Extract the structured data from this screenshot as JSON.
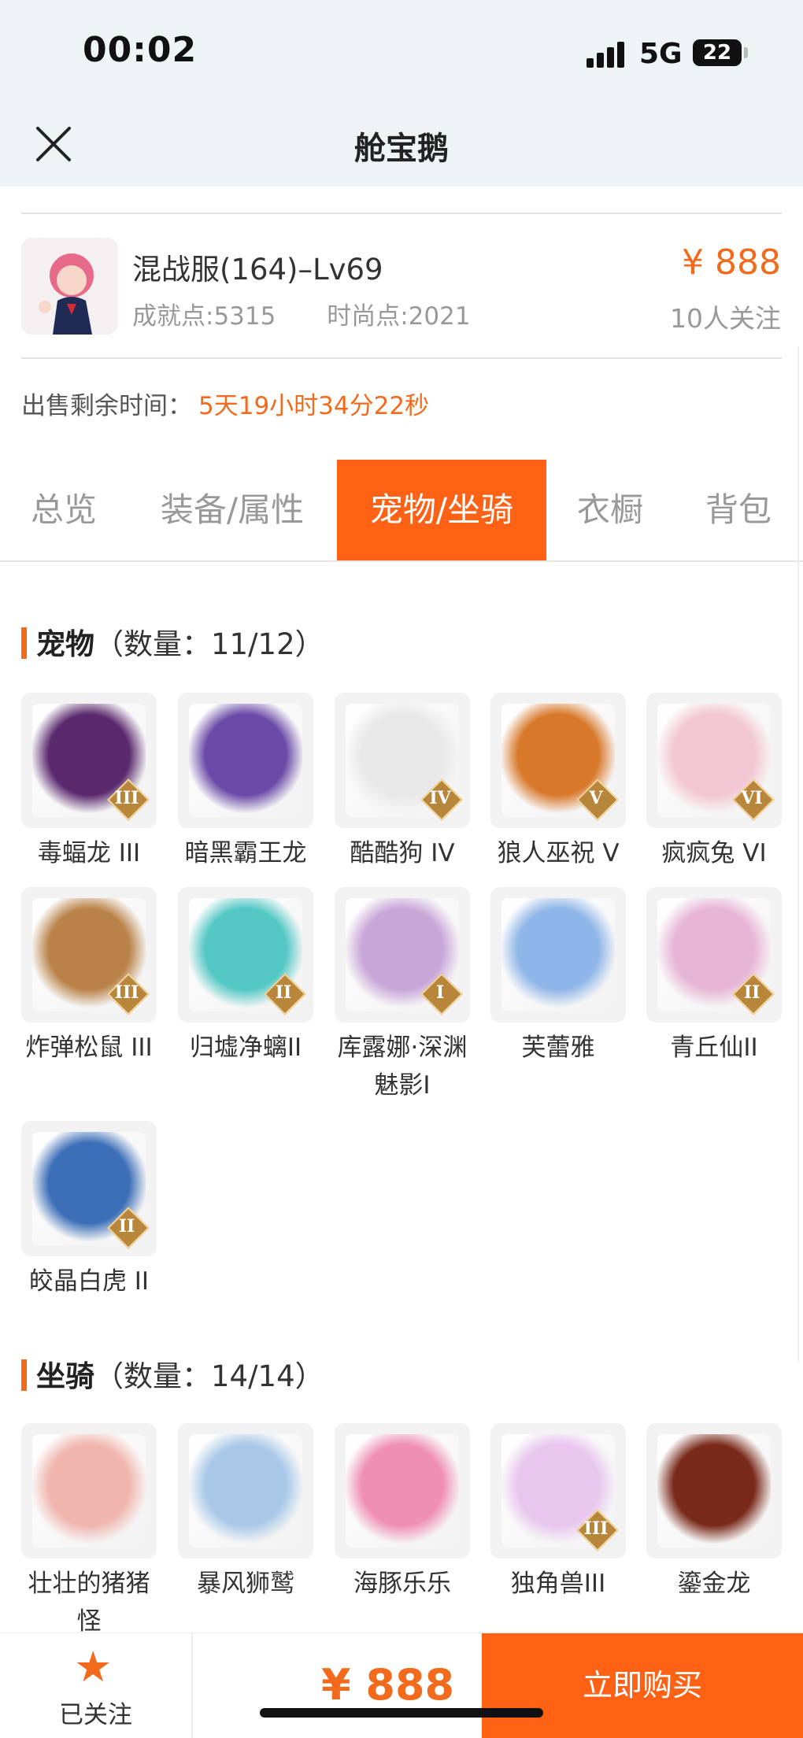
{
  "status": {
    "time": "00:02",
    "network": "5G",
    "battery": "22"
  },
  "nav": {
    "title": "舱宝鹅"
  },
  "character": {
    "name": "混战服(164)–Lv69",
    "achievement": "成就点:5315",
    "fashion": "时尚点:2021",
    "price": "¥ 888",
    "followers": "10人关注"
  },
  "sale": {
    "label": "出售剩余时间：",
    "remaining": "5天19小时34分22秒"
  },
  "tabs": [
    "总览",
    "装备/属性",
    "宠物/坐骑",
    "衣橱",
    "背包"
  ],
  "active_tab": 2,
  "pets": {
    "title": "宠物",
    "count": "（数量：11/12）",
    "items": [
      {
        "name": "毒蝠龙 III",
        "rank": "III",
        "color": "#5b2a6e"
      },
      {
        "name": "暗黑霸王龙",
        "rank": "",
        "color": "#6b4aa8"
      },
      {
        "name": "酷酷狗 IV",
        "rank": "IV",
        "color": "#e8e8e8"
      },
      {
        "name": "狼人巫祝 V",
        "rank": "V",
        "color": "#d8782a"
      },
      {
        "name": "疯疯兔 VI",
        "rank": "VI",
        "color": "#f2c6d2"
      },
      {
        "name": "炸弹松鼠 III",
        "rank": "III",
        "color": "#b98248"
      },
      {
        "name": "归墟净螭II",
        "rank": "II",
        "color": "#52c7c4"
      },
      {
        "name": "库露娜·深渊魅影I",
        "rank": "I",
        "color": "#c9a6d8"
      },
      {
        "name": "芙蕾雅",
        "rank": "",
        "color": "#8fb6e8"
      },
      {
        "name": "青丘仙II",
        "rank": "II",
        "color": "#e7b6d6"
      },
      {
        "name": "皎晶白虎 II",
        "rank": "II",
        "color": "#3d6fb8"
      }
    ]
  },
  "mounts": {
    "title": "坐骑",
    "count": "（数量：14/14）",
    "items": [
      {
        "name": "壮壮的猪猪怪",
        "rank": "",
        "color": "#f0b6ae"
      },
      {
        "name": "暴风狮鹫",
        "rank": "",
        "color": "#a9c8e8"
      },
      {
        "name": "海豚乐乐",
        "rank": "",
        "color": "#ef8fb2"
      },
      {
        "name": "独角兽III",
        "rank": "III",
        "color": "#e8c6ee"
      },
      {
        "name": "鎏金龙",
        "rank": "",
        "color": "#7a2a1a"
      }
    ]
  },
  "bottom": {
    "follow_label": "已关注",
    "star": "★",
    "price": "¥ 888",
    "buy_label": "立即购买"
  }
}
